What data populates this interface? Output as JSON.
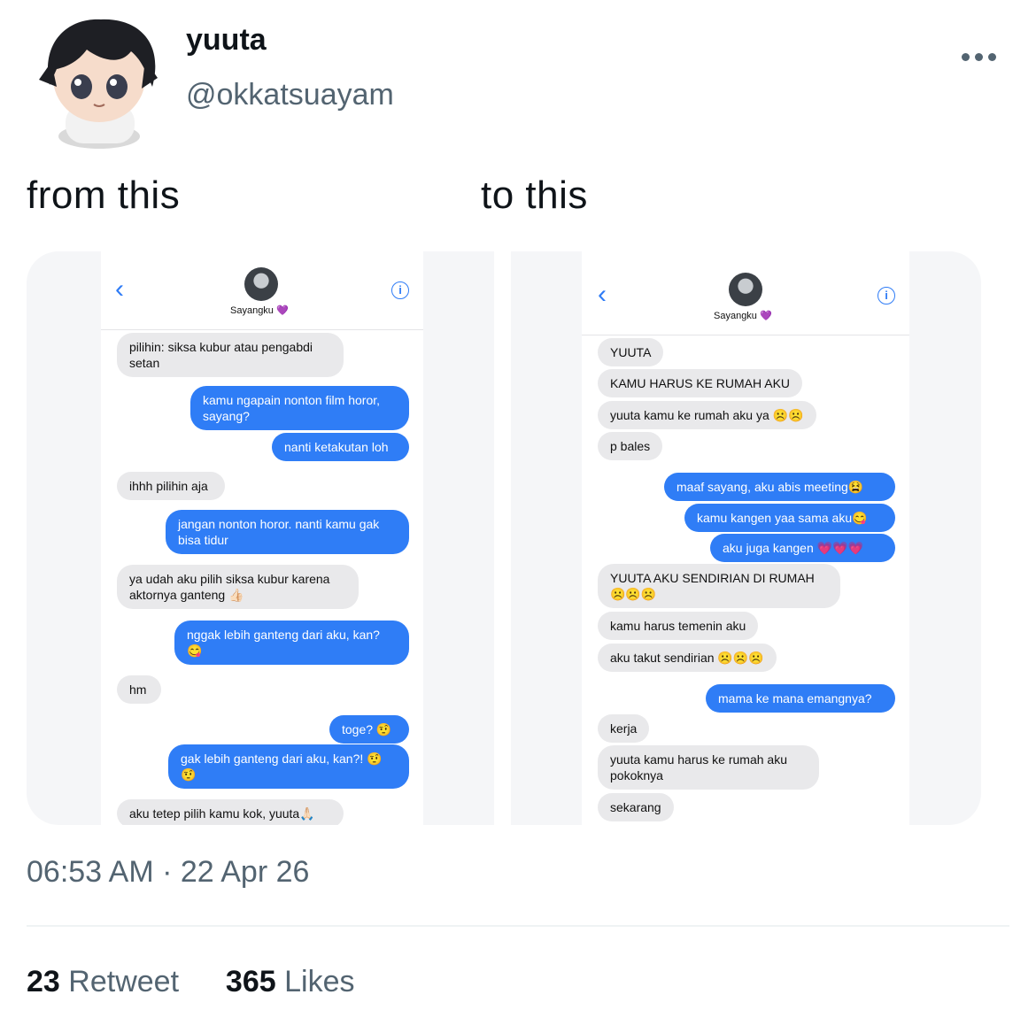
{
  "tweet": {
    "display_name": "yuuta",
    "handle": "@okkatsuayam",
    "caption_left": "from this",
    "caption_right": "to this",
    "timestamp": "06:53 AM · 22 Apr 26",
    "retweet_count": "23",
    "retweet_label": "Retweet",
    "likes_count": "365",
    "likes_label": "Likes"
  },
  "left_chat": {
    "contact": "Sayangku",
    "contact_emoji": "💜",
    "messages": [
      {
        "dir": "in",
        "text": "pilihin: siksa kubur atau pengabdi setan"
      },
      {
        "dir": "out",
        "text": "kamu ngapain nonton film horor, sayang?"
      },
      {
        "dir": "out",
        "text": "nanti ketakutan loh"
      },
      {
        "dir": "in",
        "text": "ihhh pilihin aja"
      },
      {
        "dir": "out",
        "text": "jangan nonton horor. nanti kamu gak bisa tidur"
      },
      {
        "dir": "in",
        "text": "ya udah aku pilih siksa kubur karena aktornya ganteng 👍🏻"
      },
      {
        "dir": "out",
        "text": "nggak lebih ganteng dari aku, kan? 😋"
      },
      {
        "dir": "in",
        "text": "hm"
      },
      {
        "dir": "out",
        "text": "toge? 🤨"
      },
      {
        "dir": "out",
        "text": "gak lebih ganteng dari aku, kan?! 🤨 🤨"
      },
      {
        "dir": "in",
        "text": "aku tetep pilih kamu kok, yuuta🙏🏻"
      }
    ]
  },
  "right_chat": {
    "contact": "Sayangku",
    "contact_emoji": "💜",
    "messages": [
      {
        "dir": "in",
        "text": "YUUTA"
      },
      {
        "dir": "in",
        "text": "KAMU HARUS KE RUMAH AKU"
      },
      {
        "dir": "in",
        "text": "yuuta kamu ke rumah aku ya ☹️☹️"
      },
      {
        "dir": "in",
        "text": "p bales"
      },
      {
        "dir": "out",
        "text": "maaf sayang, aku abis meeting😫"
      },
      {
        "dir": "out",
        "text": "kamu kangen yaa sama aku😋"
      },
      {
        "dir": "out",
        "text": "aku juga kangen 💗💗💗"
      },
      {
        "dir": "in",
        "text": "YUUTA AKU SENDIRIAN DI RUMAH ☹️☹️☹️"
      },
      {
        "dir": "in",
        "text": "kamu harus temenin aku"
      },
      {
        "dir": "in",
        "text": "aku takut sendirian ☹️☹️☹️"
      },
      {
        "dir": "out",
        "text": "mama ke mana emangnya?"
      },
      {
        "dir": "in",
        "text": "kerja"
      },
      {
        "dir": "in",
        "text": "yuuta kamu harus ke rumah aku pokoknya"
      },
      {
        "dir": "in",
        "text": "sekarang"
      }
    ]
  },
  "colors": {
    "imessage_blue": "#2f7df6",
    "incoming_gray": "#e9e9eb",
    "secondary_text": "#536471"
  },
  "icons": [
    "avatar",
    "more-options-icon",
    "back-chevron-icon",
    "info-icon",
    "contact-avatar"
  ]
}
